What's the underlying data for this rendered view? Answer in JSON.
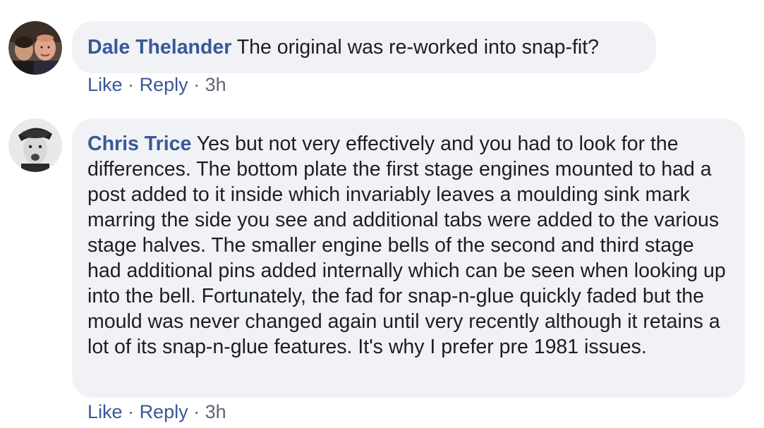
{
  "comments": [
    {
      "author": "Dale Thelander",
      "text": "The original was re-worked into snap-fit?",
      "actions": {
        "like": "Like",
        "reply": "Reply",
        "separator": "·",
        "time": "3h"
      },
      "avatar_icon": "avatar-photo-two-men"
    },
    {
      "author": "Chris Trice",
      "text": "Yes but not very effectively and you had to look for the differences. The bottom plate the first stage engines mounted to had a post added to it inside which invariably leaves a moulding sink mark marring the side you see and additional tabs were added to the various stage halves. The smaller engine bells of the second and third stage had additional pins added internally which can be seen when looking up into the bell. Fortunately, the fad for snap-n-glue quickly faded but the mould was never changed again until very recently although it retains a lot of its snap-n-glue features. It's why I prefer pre 1981 issues.",
      "actions": {
        "like": "Like",
        "reply": "Reply",
        "separator": "·",
        "time": "3h"
      },
      "avatar_icon": "avatar-photo-man-with-cap"
    }
  ],
  "colors": {
    "author": "#385898",
    "bubble_bg": "#f0f2f5",
    "text": "#1c1e21",
    "meta": "#606770"
  }
}
